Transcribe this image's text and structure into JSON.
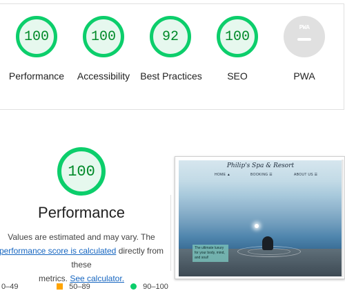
{
  "scores": [
    {
      "label": "Performance",
      "value": "100"
    },
    {
      "label": "Accessibility",
      "value": "100"
    },
    {
      "label": "Best Practices",
      "value": "92"
    },
    {
      "label": "SEO",
      "value": "100"
    },
    {
      "label": "PWA",
      "badge": "PWA"
    }
  ],
  "performance": {
    "score": "100",
    "title": "Performance",
    "desc_line1": "Values are estimated and may vary. The",
    "desc_link1": "performance score is calculated",
    "desc_mid": " directly from these",
    "desc_line3": "metrics. ",
    "desc_link2": "See calculator."
  },
  "legend": {
    "fail": "0–49",
    "average": "50–89",
    "pass": "90–100"
  },
  "screenshot": {
    "site_title": "Philip's Spa & Resort",
    "nav": [
      "HOME ▲",
      "BOOKING ☰",
      "ABOUT US ☰"
    ],
    "tagline": "The ultimate luxury for your body, mind, and soul!"
  },
  "colors": {
    "pass": "#0cce6b",
    "average": "#ffa400",
    "pass_text": "#008a29",
    "link": "#1565c0"
  }
}
